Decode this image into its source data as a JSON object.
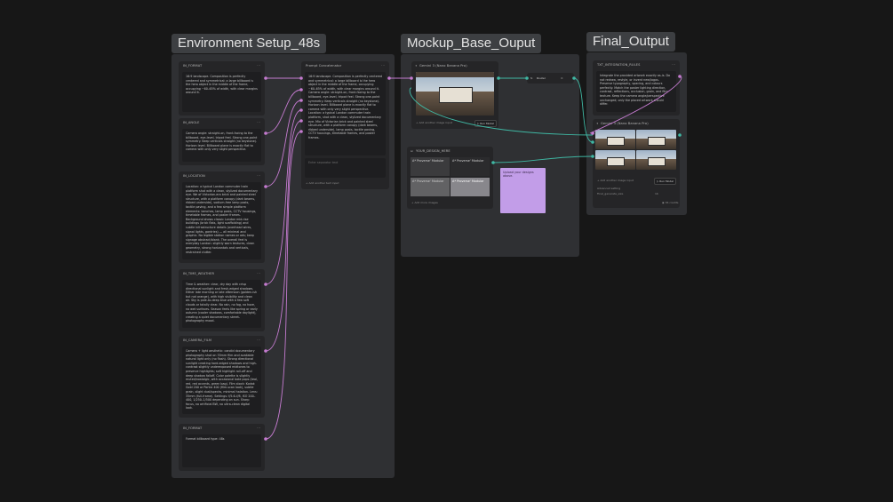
{
  "groups": {
    "env": {
      "title": "Environment Setup_48s"
    },
    "mockup": {
      "title": "Mockup_Base_Ouput"
    },
    "final": {
      "title": "Final_Output"
    }
  },
  "env_nodes": {
    "format": {
      "label": "IN_FORMAT",
      "text": "16:9 landscape. Composition is perfectly centered and symmetrical: a large billboard is the hero object in the middle of the frame, occupying ~60–65% of width, with clear margins around it."
    },
    "angle": {
      "label": "IN_ANGLE",
      "text": "Camera angle: straight-on, front-facing to the billboard, eye-level, tripod feel. Strong one-point symmetry. Keep verticals straight (no keystone). Horizon level. Billboard plane is exactly flat to camera with only very slight perspective."
    },
    "location": {
      "label": "IN_LOCATION",
      "text": "Location: a typical London commuter train platform shot with a clean, stylized documentary eye. We of Victorian-era brick and painted steel structure, with a platform canopy (dark beams, ribbed underside), sodium-free lamp posts, tactile paving, and a few simple platform elements: benches, lamp posts, CCTV housings, timetable frames, and poster frames. Background shows classic London mid-rise buildings (brick flats, light scaffolding) and subtle infrastructure details (overhead wires, signal lights, gantries) — all minimal and graphic. No legible station names or ads; keep signage abstract/blank. The overall feel is everyday London: slightly worn textures, clean geometry, strong horizontals and verticals, restrained clutter."
    },
    "time_weather": {
      "label": "IN_TIME_WEATHER",
      "text": "Time & weather: clear, dry day with crisp directional sunlight and fresh-edged shadows. Either late morning or late afternoon (golden-ish but not orange), with high visibility and clean air. Sky is pale-to-deep blue with a few soft clouds or totally clear. No rain, no fog, no haze, no wet surfaces. Season feels like spring or early autumn (cooler shadows, comfortable daylight), creating a quiet documentary street-photography mood."
    },
    "camera": {
      "label": "IN_CAMERA_FILM",
      "text": "Camera + light aesthetic: candid documentary photography shot on 35mm film and available natural light only (no flash). Strong directional sunlight creating hard-edged shadows and high-contrast slightly underexposed midtones to preserve highlights; soft highlight roll-off and deep shadow falloff. Color palette is slightly muted/nostalgic, with occasional bold pops (teal, red, red accents, green bag). Film stock: Kodak Gold 200 or Portra 400 (film-scan look), subtle grain, slight dust/specks, minimal halation. Lens: 35mm (full-frame). Settings: f/5.6–f/8, ISO 200–400, 1/250–1/500 depending on sun. Sharp focus, no artificial BW, no ultra-clean digital look."
    },
    "format2": {
      "label": "IN_FORMAT",
      "text": "Format billboard type: 48s"
    }
  },
  "prompt_node": {
    "label": "Prompt Concatenator",
    "text": "16:9 landscape. Composition is perfectly centered and symmetrical: a large billboard is the hero object in the middle of the frame, occupying ~60–65% of width, with clear margins around it. Camera angle: straight-on, front-facing to the billboard, eye-level, tripod feel. Strong one-point symmetry. Keep verticals straight (no keystone). Horizon level. Billboard plane is exactly flat to camera with only very slight perspective. Location: a typical London commuter train platform, shot with a clean, stylized documentary eye. Mix of Victorian brick and painted steel structure, with a platform canopy (dark beams, ribbed underside), lamp posts, tactile paving, CCTV housings, timetable frames, and poster frames.",
    "placeholder": "Enter separator text",
    "add_input": "+ Add another text input"
  },
  "gemini_node": {
    "label": "Gemini 3 (Nano Banana Pro)",
    "add_image": "+ Add another image input",
    "run": "▷ Run Model"
  },
  "router_node": {
    "label": "Router"
  },
  "design_node": {
    "label": "YOUR_DESIGN_HERE",
    "tile1": "A* Proverse' Modular",
    "tile2": "A* Proverse' Modular",
    "tile3": "A* Proverse' Modular",
    "tile4": "A* Proverse' Modular",
    "add_input": "+ Add more images"
  },
  "sticky_note": {
    "text": "Upload your designs above."
  },
  "integration_node": {
    "label": "TXT_INTEGRATION_RULES",
    "text": "Integrate the provided artwork exactly as-is. Do not redraw, restyle, or invent new/logos. Preserve typography, spacing, and colours perfectly. Match the poster lighting direction, contrast, reflections, occlusion, grain, and film texture. Keep the camera angle/perspective unchanged; only the placed artwork should differ."
  },
  "gemini_final": {
    "label": "Gemini 3 (Nano Banana Pro)",
    "add_image": "+ Add another image input",
    "run": "▷ Run Model",
    "setting1": "Advanced setting",
    "setting2": "Final_generate_size",
    "setting3": "1K",
    "cost": "◉ 36 credits"
  },
  "colors": {
    "wire_purple": "#c57bd0",
    "wire_teal": "#3fb7a3",
    "sticky": "#c29de8"
  }
}
